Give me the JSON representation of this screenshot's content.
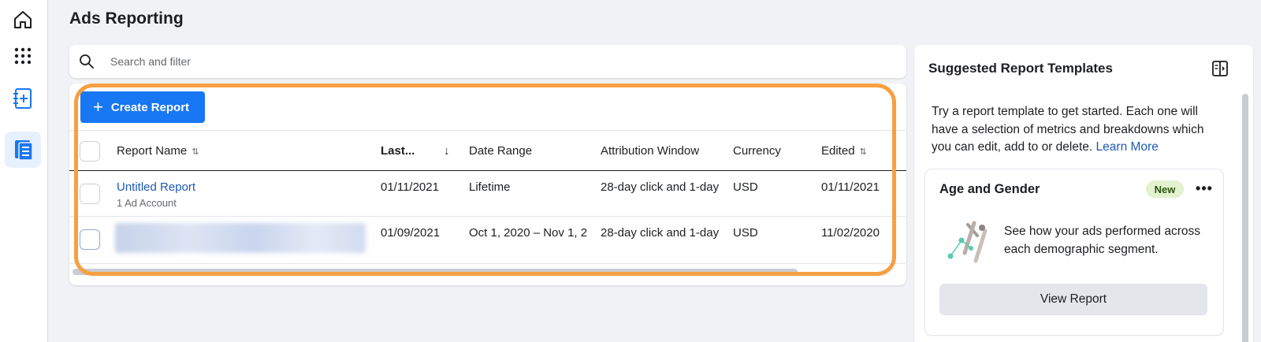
{
  "page": {
    "title": "Ads Reporting"
  },
  "nav": {
    "icons": [
      "home-icon",
      "apps-grid-icon",
      "create-report-icon",
      "reports-icon"
    ]
  },
  "search": {
    "placeholder": "Search and filter"
  },
  "toolbar": {
    "create_label": "Create Report"
  },
  "table": {
    "columns": [
      "Report Name",
      "Last...",
      "Date Range",
      "Attribution Window",
      "Currency",
      "Edited"
    ],
    "sort_icons": {
      "report_name": "⇅",
      "last_opened": "↓",
      "edited": "⇅"
    },
    "rows": [
      {
        "name": "Untitled Report",
        "sub": "1 Ad Account",
        "last": "01/11/2021",
        "date_range": "Lifetime",
        "attribution": "28-day click and 1-day",
        "currency": "USD",
        "edited": "01/11/2021"
      },
      {
        "name": "",
        "sub": "",
        "last": "01/09/2021",
        "date_range": "Oct 1, 2020 – Nov 1, 2",
        "attribution": "28-day click and 1-day",
        "currency": "USD",
        "edited": "11/02/2020"
      }
    ]
  },
  "panel": {
    "title": "Suggested Report Templates",
    "desc": "Try a report template to get started. Each one will have a selection of metrics and breakdowns which you can edit, add to or delete.",
    "learn_more": "Learn More",
    "card": {
      "title": "Age and Gender",
      "badge": "New",
      "more": "•••",
      "text": "See how your ads performed across each demographic segment.",
      "button": "View Report"
    }
  },
  "colors": {
    "primary": "#1877f2",
    "highlight": "#f7a042",
    "link": "#1b5bb5",
    "badge_bg": "#e3f2cf"
  }
}
